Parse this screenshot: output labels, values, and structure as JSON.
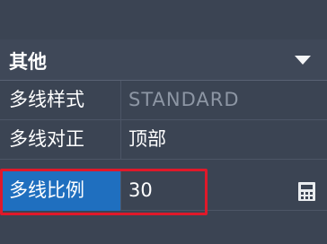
{
  "section": {
    "title": "其他"
  },
  "rows": [
    {
      "label": "多线样式",
      "value": "STANDARD"
    },
    {
      "label": "多线对正",
      "value": "顶部"
    },
    {
      "label": "多线比例",
      "value": "30"
    }
  ],
  "icons": {
    "collapse": "chevron-down-icon",
    "calculator": "calculator-icon"
  },
  "colors": {
    "background": "#3b4453",
    "selected_label": "#1f6fbf",
    "highlight": "#e0192a"
  }
}
